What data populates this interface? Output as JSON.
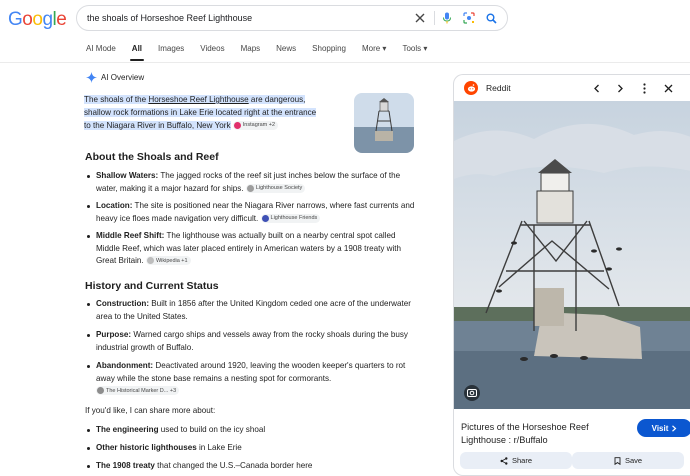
{
  "header": {
    "logo_letters": [
      {
        "ch": "G",
        "color": "#4285f4"
      },
      {
        "ch": "o",
        "color": "#ea4335"
      },
      {
        "ch": "o",
        "color": "#fbbc05"
      },
      {
        "ch": "g",
        "color": "#4285f4"
      },
      {
        "ch": "l",
        "color": "#34a853"
      },
      {
        "ch": "e",
        "color": "#ea4335"
      }
    ],
    "query": "the shoals of Horseshoe Reef Lighthouse",
    "icons": [
      "clear-icon",
      "microphone-icon",
      "lens-icon",
      "search-icon"
    ]
  },
  "tabs": [
    {
      "label": "AI Mode"
    },
    {
      "label": "All",
      "active": true
    },
    {
      "label": "Images"
    },
    {
      "label": "Videos"
    },
    {
      "label": "Maps"
    },
    {
      "label": "News"
    },
    {
      "label": "Shopping"
    },
    {
      "label": "More ▾"
    },
    {
      "label": "Tools ▾"
    }
  ],
  "overview": {
    "heading": "AI Overview",
    "lead_1": "The shoals of the ",
    "lead_link": "Horseshoe Reef Lighthouse",
    "lead_2": " are ",
    "lead_3": "dangerous, shallow rock formations in Lake Erie located right at the entrance to the Niagara River in Buffalo, New York",
    "lead_chip": "Instagram +2",
    "section1": "About the Shoals and Reef",
    "s1_items": [
      {
        "bold": "Shallow Waters:",
        "text": " The jagged rocks of the reef sit just inches below the surface of the water, making it a major hazard for ships.",
        "chip": "Lighthouse Society"
      },
      {
        "bold": "Location:",
        "text": " The site is positioned near the Niagara River narrows, where fast currents and heavy ice floes made navigation very difficult.",
        "chip": "Lighthouse Friends"
      },
      {
        "bold": "Middle Reef Shift:",
        "text": " The lighthouse was actually built on a nearby central spot called Middle Reef, which was later placed entirely in American waters by a 1908 treaty with Great Britain.",
        "chip": "Wikipedia +1"
      }
    ],
    "section2": "History and Current Status",
    "s2_items": [
      {
        "bold": "Construction:",
        "text": " Built in 1856 after the United Kingdom ceded one acre of the underwater area to the United States."
      },
      {
        "bold": "Purpose:",
        "text": " Warned cargo ships and vessels away from the rocky shoals during the busy industrial growth of Buffalo."
      },
      {
        "bold": "Abandonment:",
        "text": " Deactivated around 1920, leaving the wooden keeper's quarters to rot away while the stone base remains a nesting spot for cormorants.",
        "chip": "The Historical Marker D... +3"
      }
    ],
    "more_prompt": "If you'd like, I can share more about:",
    "more_items": [
      {
        "bold": "The engineering",
        "text": " used to build on the icy shoal"
      },
      {
        "bold": "Other historic lighthouses",
        "text": " in Lake Erie"
      },
      {
        "bold": "The 1908 treaty",
        "text": " that changed the U.S.–Canada border here"
      }
    ]
  },
  "panel": {
    "source": "Reddit",
    "title": "Pictures of the Horseshoe Reef Lighthouse : r/Buffalo",
    "visit_label": "Visit",
    "share_label": "Share",
    "save_label": "Save"
  },
  "colors": {
    "accent": "#0b57d0",
    "highlight": "#d3e3fd",
    "reddit": "#ff4500"
  }
}
